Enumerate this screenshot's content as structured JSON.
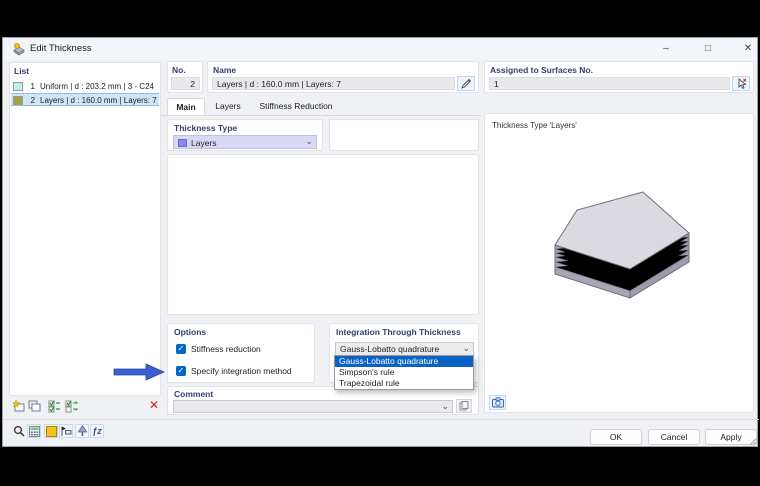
{
  "window": {
    "title": "Edit Thickness",
    "minimize": "–",
    "maximize": "□",
    "close": "✕"
  },
  "icons": {
    "check": "✓",
    "chevron": "⌄",
    "delete_x": "✕",
    "list_check": "✓✓",
    "list_swap": "⇄",
    "function_glyph": "ƒz"
  },
  "list_panel": {
    "label": "List",
    "items": [
      {
        "number": "1",
        "text": "Uniform | d : 203.2 mm | 3 - C24",
        "swatch": "#c5eef2",
        "selected": false
      },
      {
        "number": "2",
        "text": "Layers | d : 160.0 mm | Layers: 7",
        "swatch": "#a3a339",
        "selected": true
      }
    ]
  },
  "header": {
    "no": {
      "label": "No.",
      "value": "2"
    },
    "name": {
      "label": "Name",
      "value": "Layers | d : 160.0 mm | Layers: 7"
    },
    "assigned": {
      "label": "Assigned to Surfaces No.",
      "value": "1"
    }
  },
  "tabs": [
    {
      "label": "Main",
      "active": true
    },
    {
      "label": "Layers",
      "active": false
    },
    {
      "label": "Stiffness Reduction",
      "active": false
    }
  ],
  "main_tab": {
    "thickness_type": {
      "label": "Thickness Type",
      "value": "Layers",
      "swatch": "#8888ee"
    },
    "options": {
      "label": "Options",
      "checkboxes": [
        {
          "label": "Stiffness reduction",
          "checked": true
        },
        {
          "label": "Specify integration method",
          "checked": true
        }
      ]
    },
    "integration": {
      "label": "Integration Through Thickness",
      "value": "Gauss-Lobatto quadrature",
      "options": [
        "Gauss-Lobatto quadrature",
        "Simpson's rule",
        "Trapezoidal rule"
      ],
      "selected_index": 0
    },
    "comment": {
      "label": "Comment",
      "value": ""
    }
  },
  "preview_panel": {
    "title": "Thickness Type  'Layers'"
  },
  "footer": {
    "ok": "OK",
    "cancel": "Cancel",
    "apply": "Apply"
  },
  "colors": {
    "accent": "#0067c4",
    "annotation_arrow": "#3b5fd2",
    "swatch_uniform": "#c5eef2",
    "swatch_layers": "#a3a339",
    "type_swatch": "#8888ee"
  }
}
